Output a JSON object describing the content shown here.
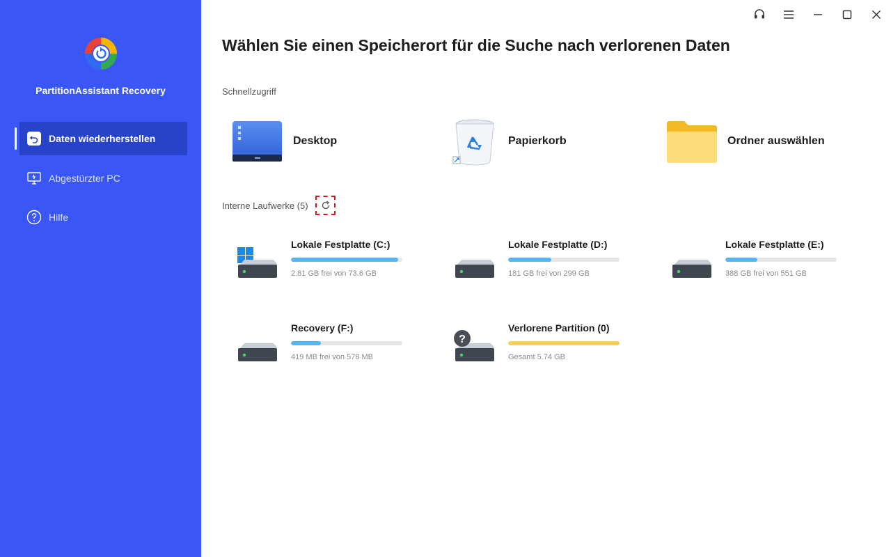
{
  "app": {
    "name": "PartitionAssistant Recovery"
  },
  "sidebar": {
    "items": [
      {
        "label": "Daten wiederherstellen",
        "active": true,
        "icon": "restore-icon"
      },
      {
        "label": "Abgestürzter PC",
        "active": false,
        "icon": "monitor-icon"
      },
      {
        "label": "Hilfe",
        "active": false,
        "icon": "help-icon"
      }
    ]
  },
  "window_controls": [
    "headset-icon",
    "menu-icon",
    "minimize-icon",
    "maximize-icon",
    "close-icon"
  ],
  "main": {
    "title": "Wählen Sie einen Speicherort für die Suche nach verlorenen Daten",
    "quick_access": {
      "label": "Schnellzugriff",
      "items": [
        {
          "label": "Desktop",
          "icon": "desktop-icon"
        },
        {
          "label": "Papierkorb",
          "icon": "recycle-bin-icon"
        },
        {
          "label": "Ordner auswählen",
          "icon": "folder-icon"
        }
      ]
    },
    "internal_drives": {
      "label": "Interne Laufwerke (5)",
      "drives": [
        {
          "name": "Lokale Festplatte (C:)",
          "size": "2.81 GB frei von 73.6 GB",
          "used_fraction": 0.96,
          "color": "#56b6ef",
          "badge": "windows-logo"
        },
        {
          "name": "Lokale Festplatte (D:)",
          "size": "181 GB frei von 299 GB",
          "used_fraction": 0.39,
          "color": "#56b6ef",
          "badge": ""
        },
        {
          "name": "Lokale Festplatte (E:)",
          "size": "388 GB frei von 551 GB",
          "used_fraction": 0.29,
          "color": "#56b6ef",
          "badge": ""
        },
        {
          "name": "Recovery (F:)",
          "size": "419 MB frei von 578 MB",
          "used_fraction": 0.27,
          "color": "#56b6ef",
          "badge": ""
        },
        {
          "name": "Verlorene Partition (0)",
          "size": "Gesamt 5.74 GB",
          "used_fraction": 1.0,
          "color": "#f6cf55",
          "badge": "question"
        }
      ]
    }
  },
  "colors": {
    "sidebar": "#3a57f5",
    "active_nav": "#2743c9",
    "bar_fill": "#56b6ef",
    "lost_fill": "#f6cf55",
    "highlight": "#d0161f"
  }
}
